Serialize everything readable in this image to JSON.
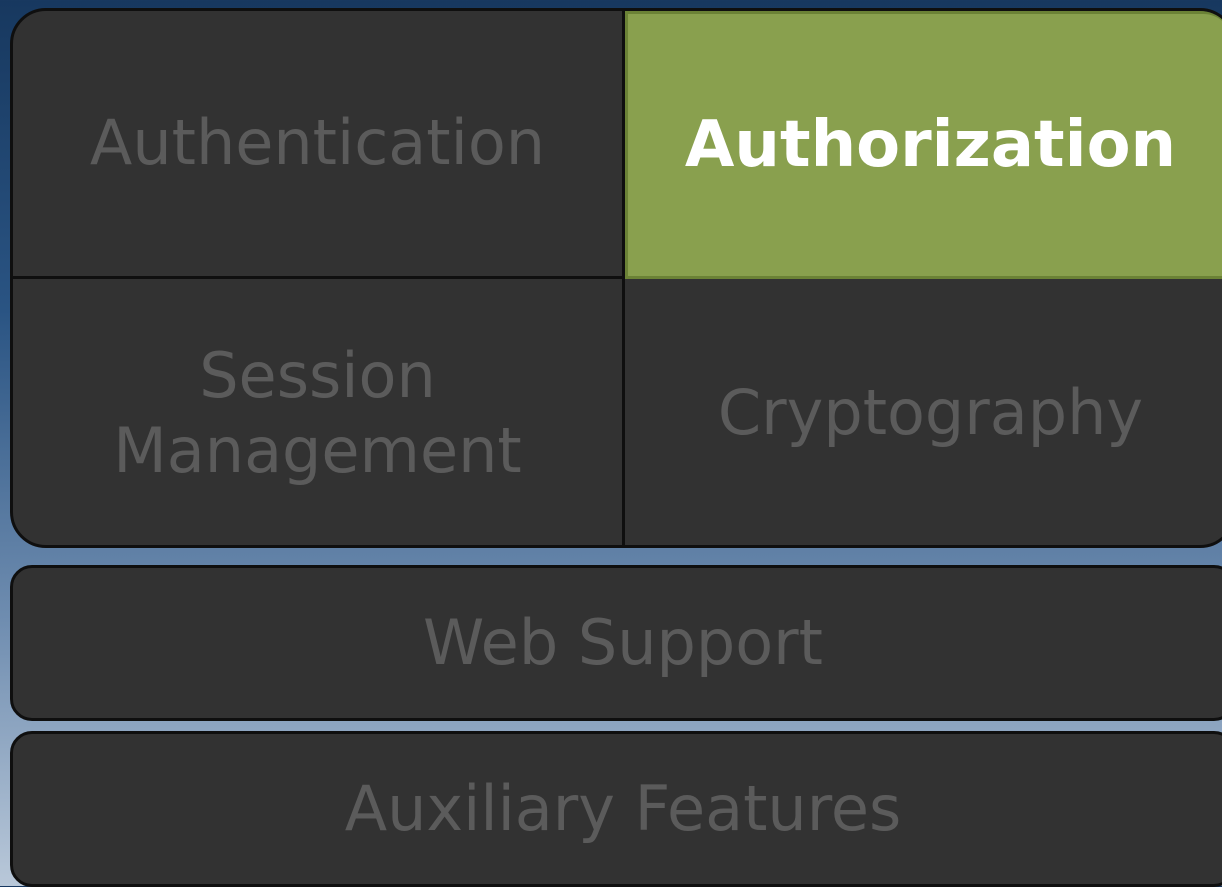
{
  "top_group": {
    "authentication": "Authentication",
    "authorization": "Authorization",
    "session_management_line1": "Session",
    "session_management_line2": "Management",
    "cryptography": "Cryptography"
  },
  "web_support": "Web Support",
  "auxiliary_features": "Auxiliary Features",
  "colors": {
    "highlight": "#89a04e",
    "block": "#323232",
    "text_dim": "#5b5b5b",
    "text_highlight": "#ffffff"
  }
}
